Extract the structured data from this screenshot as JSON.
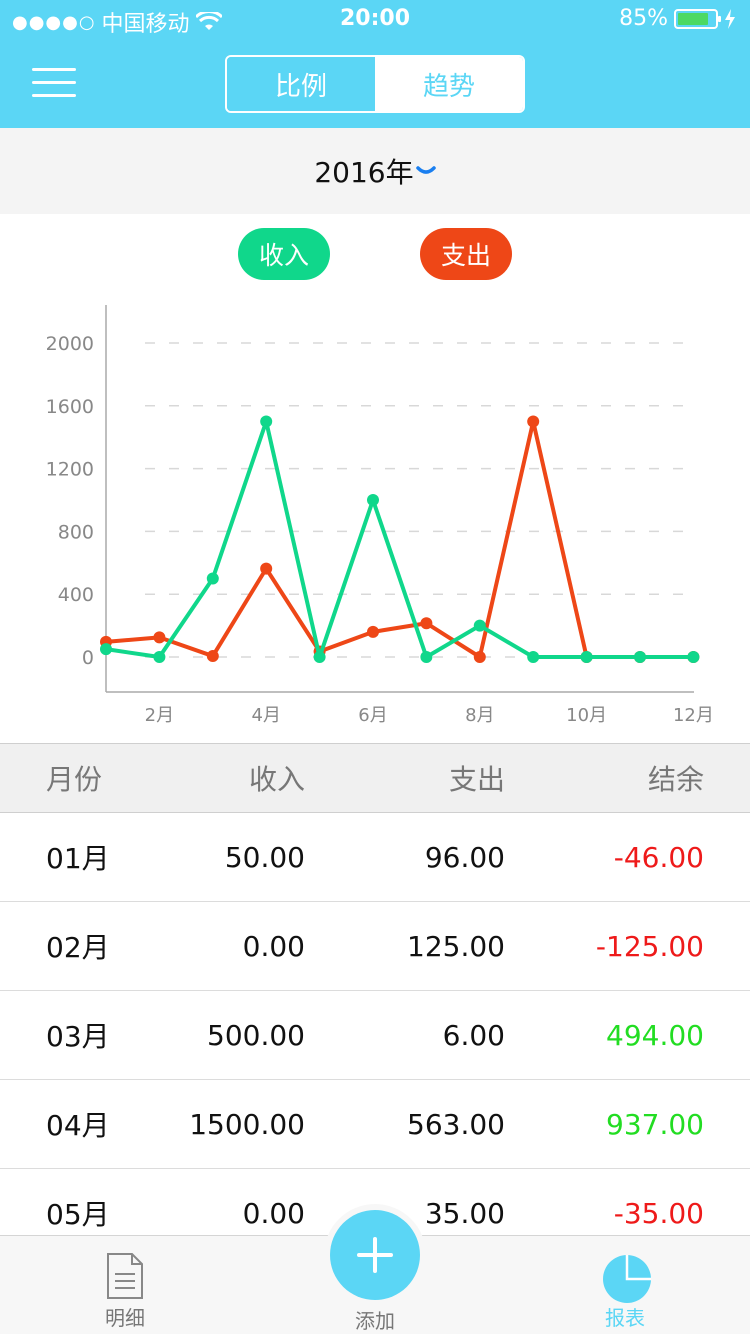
{
  "status_bar": {
    "signal": "●●●●○",
    "carrier": "中国移动",
    "time": "20:00",
    "battery": "85%"
  },
  "header": {
    "segments": [
      {
        "label": "比例",
        "active": true
      },
      {
        "label": "趋势",
        "active": false
      }
    ]
  },
  "year_selector": {
    "label": "2016年"
  },
  "legend": {
    "income": "收入",
    "expense": "支出"
  },
  "colors": {
    "accent": "#5bd6f5",
    "income": "#10d78b",
    "expense": "#ee4717",
    "negative": "#ee1a1a",
    "positive": "#22dd22"
  },
  "chart_data": {
    "type": "line",
    "x": [
      1,
      2,
      3,
      4,
      5,
      6,
      7,
      8,
      9,
      10,
      11,
      12
    ],
    "tick_labels": [
      "2月",
      "4月",
      "6月",
      "8月",
      "10月",
      "12月"
    ],
    "tick_positions": [
      2,
      4,
      6,
      8,
      10,
      12
    ],
    "ylim": [
      0,
      2000
    ],
    "yticks": [
      0,
      400,
      800,
      1200,
      1600,
      2000
    ],
    "grid": true,
    "series": [
      {
        "name": "收入",
        "color": "#10d78b",
        "values": [
          50,
          0,
          500,
          1500,
          0,
          1000,
          0,
          200,
          0,
          0,
          0,
          0
        ]
      },
      {
        "name": "支出",
        "color": "#ee4717",
        "values": [
          96,
          125,
          6,
          563,
          35,
          160,
          215,
          0,
          1500,
          0,
          0,
          0
        ]
      }
    ]
  },
  "table": {
    "headers": {
      "month": "月份",
      "income": "收入",
      "expense": "支出",
      "balance": "结余"
    },
    "rows": [
      {
        "month": "01月",
        "income": "50.00",
        "expense": "96.00",
        "balance": "-46.00",
        "sign": "neg"
      },
      {
        "month": "02月",
        "income": "0.00",
        "expense": "125.00",
        "balance": "-125.00",
        "sign": "neg"
      },
      {
        "month": "03月",
        "income": "500.00",
        "expense": "6.00",
        "balance": "494.00",
        "sign": "pos"
      },
      {
        "month": "04月",
        "income": "1500.00",
        "expense": "563.00",
        "balance": "937.00",
        "sign": "pos"
      },
      {
        "month": "05月",
        "income": "0.00",
        "expense": "35.00",
        "balance": "-35.00",
        "sign": "neg"
      }
    ]
  },
  "tab_bar": {
    "details": {
      "label": "明细",
      "icon": "document-icon"
    },
    "add": {
      "label": "添加",
      "icon": "plus-icon"
    },
    "report": {
      "label": "报表",
      "icon": "pie-chart-icon",
      "active": true
    }
  }
}
